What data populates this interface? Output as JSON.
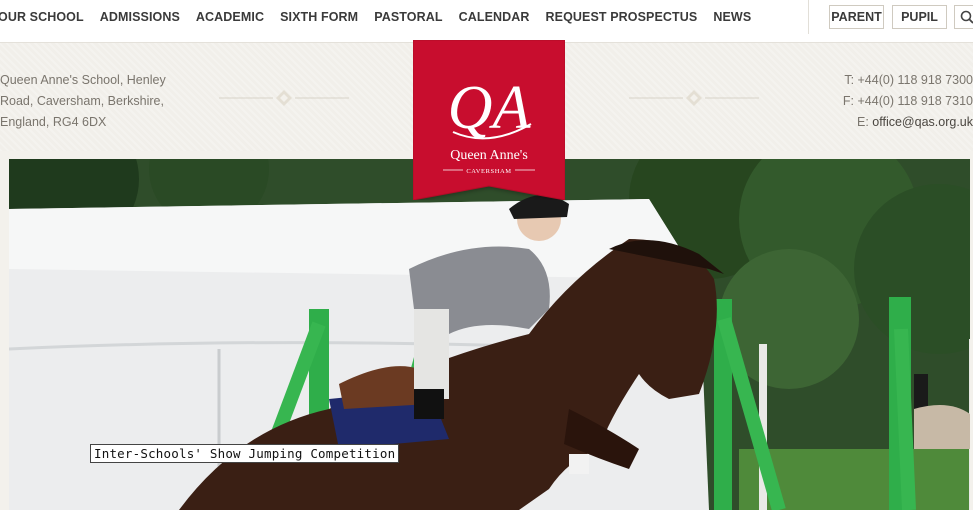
{
  "nav": {
    "items": [
      "OUR SCHOOL",
      "ADMISSIONS",
      "ACADEMIC",
      "SIXTH FORM",
      "PASTORAL",
      "CALENDAR",
      "REQUEST PROSPECTUS",
      "NEWS"
    ],
    "parent_label": "PARENT",
    "pupil_label": "PUPIL"
  },
  "address": {
    "line1": "Queen Anne's School, Henley",
    "line2": "Road, Caversham, Berkshire,",
    "line3": "England, RG4 6DX"
  },
  "contact": {
    "phone": "T: +44(0) 118 918 7300",
    "fax": "F: +44(0) 118 918 7310",
    "email_prefix": "E: ",
    "email": "office@qas.org.uk"
  },
  "logo": {
    "monogram": "QA",
    "name": "Queen Anne's",
    "place": "CAVERSHAM",
    "color": "#c8102e"
  },
  "hero": {
    "caption": "Inter-Schools' Show Jumping Competition"
  }
}
